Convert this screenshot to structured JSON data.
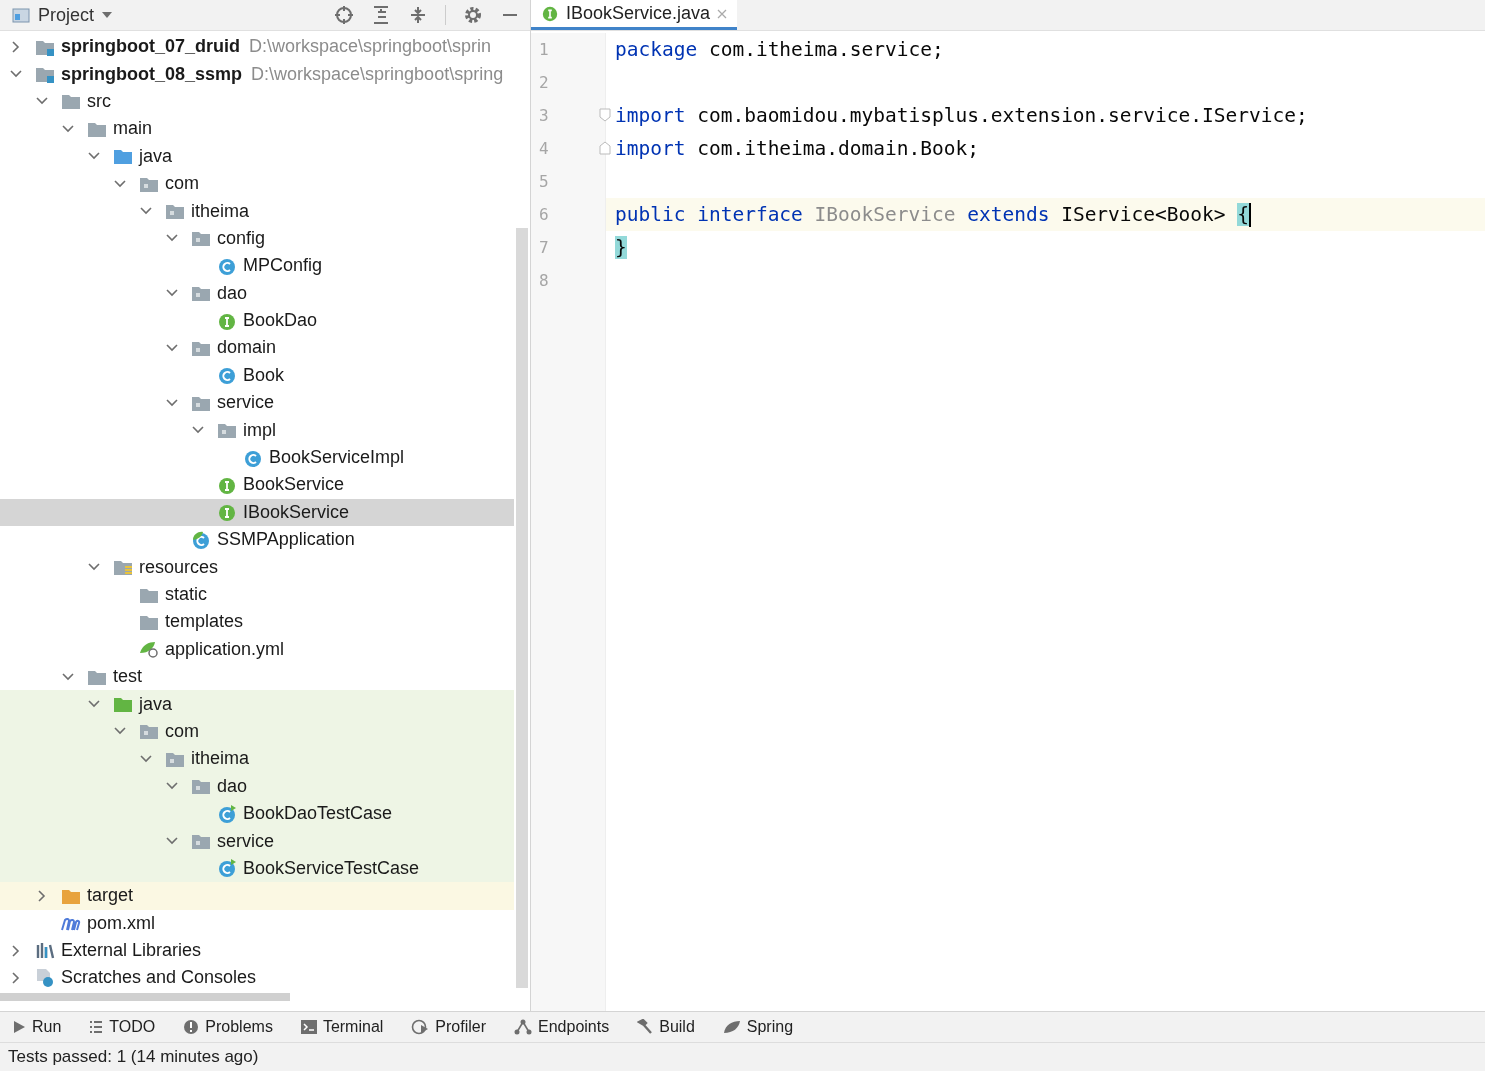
{
  "toolbar": {
    "title": "Project"
  },
  "tree": [
    {
      "label": "springboot_07_druid",
      "kind": "module",
      "path": "D:\\workspace\\springboot\\sprin",
      "expanded": false,
      "selected": false
    },
    {
      "label": "springboot_08_ssmp",
      "kind": "module",
      "path": "D:\\workspace\\springboot\\spring",
      "expanded": true,
      "selected": false,
      "children": [
        {
          "label": "src",
          "kind": "folder",
          "expanded": true,
          "selected": false,
          "children": [
            {
              "label": "main",
              "kind": "folder",
              "expanded": true,
              "selected": false,
              "children": [
                {
                  "label": "java",
                  "kind": "source",
                  "expanded": true,
                  "selected": false,
                  "children": [
                    {
                      "label": "com",
                      "kind": "package",
                      "expanded": true,
                      "selected": false,
                      "children": [
                        {
                          "label": "itheima",
                          "kind": "package",
                          "expanded": true,
                          "selected": false,
                          "children": [
                            {
                              "label": "config",
                              "kind": "package",
                              "expanded": true,
                              "selected": false,
                              "children": [
                                {
                                  "label": "MPConfig",
                                  "kind": "class",
                                  "selected": false
                                }
                              ]
                            },
                            {
                              "label": "dao",
                              "kind": "package",
                              "expanded": true,
                              "selected": false,
                              "children": [
                                {
                                  "label": "BookDao",
                                  "kind": "interface",
                                  "selected": false
                                }
                              ]
                            },
                            {
                              "label": "domain",
                              "kind": "package",
                              "expanded": true,
                              "selected": false,
                              "children": [
                                {
                                  "label": "Book",
                                  "kind": "class",
                                  "selected": false
                                }
                              ]
                            },
                            {
                              "label": "service",
                              "kind": "package",
                              "expanded": true,
                              "selected": false,
                              "children": [
                                {
                                  "label": "impl",
                                  "kind": "package",
                                  "expanded": true,
                                  "selected": false,
                                  "children": [
                                    {
                                      "label": "BookServiceImpl",
                                      "kind": "class",
                                      "selected": false
                                    }
                                  ]
                                },
                                {
                                  "label": "BookService",
                                  "kind": "interface",
                                  "selected": false
                                },
                                {
                                  "label": "IBookService",
                                  "kind": "interface",
                                  "selected": true
                                }
                              ]
                            },
                            {
                              "label": "SSMPApplication",
                              "kind": "application",
                              "selected": false
                            }
                          ]
                        }
                      ]
                    }
                  ]
                },
                {
                  "label": "resources",
                  "kind": "resources",
                  "expanded": true,
                  "selected": false,
                  "children": [
                    {
                      "label": "static",
                      "kind": "folder",
                      "selected": false
                    },
                    {
                      "label": "templates",
                      "kind": "folder",
                      "selected": false
                    },
                    {
                      "label": "application.yml",
                      "kind": "config",
                      "selected": false
                    }
                  ]
                }
              ]
            },
            {
              "label": "test",
              "kind": "folder",
              "expanded": true,
              "selected": false,
              "children": [
                {
                  "label": "java",
                  "kind": "testsource",
                  "expanded": true,
                  "selected": false,
                  "test": true,
                  "children": [
                    {
                      "label": "com",
                      "kind": "package",
                      "expanded": true,
                      "selected": false,
                      "children": [
                        {
                          "label": "itheima",
                          "kind": "package",
                          "expanded": true,
                          "selected": false,
                          "children": [
                            {
                              "label": "dao",
                              "kind": "package",
                              "expanded": true,
                              "selected": false,
                              "children": [
                                {
                                  "label": "BookDaoTestCase",
                                  "kind": "testclass",
                                  "selected": false
                                }
                              ]
                            },
                            {
                              "label": "service",
                              "kind": "package",
                              "expanded": true,
                              "selected": false,
                              "children": [
                                {
                                  "label": "BookServiceTestCase",
                                  "kind": "testclass",
                                  "selected": false
                                }
                              ]
                            }
                          ]
                        }
                      ]
                    }
                  ]
                }
              ]
            }
          ]
        },
        {
          "label": "target",
          "kind": "excludedfolder",
          "expanded": false,
          "selected": false,
          "excluded": true
        },
        {
          "label": "pom.xml",
          "kind": "maven",
          "selected": false
        }
      ]
    },
    {
      "label": "External Libraries",
      "kind": "libraries",
      "expanded": false,
      "selected": false
    },
    {
      "label": "Scratches and Consoles",
      "kind": "scratches",
      "expanded": false,
      "selected": false
    }
  ],
  "editor": {
    "tab": {
      "label": "IBookService.java",
      "selected": true
    },
    "lines": [
      {
        "number": "1",
        "kind": "code",
        "tokens": [
          {
            "kind": "keyword",
            "text": "package"
          },
          {
            "kind": "plain",
            "text": " com.itheima.service;"
          }
        ]
      },
      {
        "number": "2",
        "kind": "code"
      },
      {
        "number": "3",
        "kind": "opener",
        "tokens": [
          {
            "kind": "keyword",
            "text": "import"
          },
          {
            "kind": "plain",
            "text": " com.baomidou.mybatisplus.extension.service.IService;"
          }
        ]
      },
      {
        "number": "4",
        "kind": "closer",
        "tokens": [
          {
            "kind": "keyword",
            "text": "import"
          },
          {
            "kind": "plain",
            "text": " com.itheima.domain.Book;"
          }
        ]
      },
      {
        "number": "5",
        "kind": "code"
      },
      {
        "number": "6",
        "kind": "code",
        "current": true,
        "tokens": [
          {
            "kind": "keyword",
            "text": "public"
          },
          {
            "kind": "keyword",
            "text": " interface"
          },
          {
            "kind": "unused",
            "text": " IBookService"
          },
          {
            "kind": "keyword",
            "text": " extends"
          },
          {
            "kind": "plain",
            "text": " IService<Book> "
          },
          {
            "kind": "brace",
            "matched": true,
            "caret": true,
            "text": "{"
          }
        ]
      },
      {
        "number": "7",
        "kind": "code",
        "current": false,
        "tokens": [
          {
            "kind": "brace",
            "matched": true,
            "text": "}"
          }
        ]
      },
      {
        "number": "8",
        "kind": "code"
      }
    ]
  },
  "tool_windows": [
    {
      "label": "Run",
      "kind": "run"
    },
    {
      "label": "TODO",
      "kind": "list"
    },
    {
      "label": "Problems",
      "kind": "problems"
    },
    {
      "label": "Terminal",
      "kind": "terminal"
    },
    {
      "label": "Profiler",
      "kind": "profiler"
    },
    {
      "label": "Endpoints",
      "kind": "endpoints"
    },
    {
      "label": "Build",
      "kind": "hammer"
    },
    {
      "label": "Spring",
      "kind": "leaf"
    }
  ],
  "status_bar": {
    "text": "Tests passed: 1 (14 minutes ago)"
  }
}
